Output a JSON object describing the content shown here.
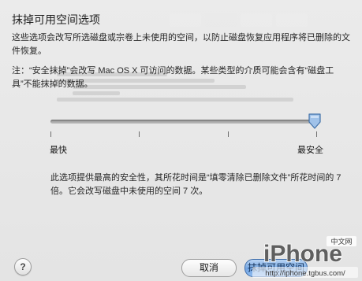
{
  "sheet": {
    "title": "抹掉可用空间选项",
    "description": "这些选项会改写所选磁盘或宗卷上未使用的空间，以防止磁盘恢复应用程序将已删除的文件恢复。",
    "note": "注：“安全抹掉”会改写 Mac OS X 可访问的数据。某些类型的介质可能会含有“磁盘工具”不能抹掉的数据。"
  },
  "slider": {
    "min_label": "最快",
    "max_label": "最安全",
    "tick_count": 4,
    "value_fraction": 1.0
  },
  "explanation": "此选项提供最高的安全性，其所花时间是“填零清除已删除文件”所花时间的 7 倍。它会改写磁盘中未使用的空间 7 次。",
  "buttons": {
    "help": "?",
    "cancel": "取消",
    "ok": "抹掉可用空间"
  },
  "watermark": {
    "brand": "iPhone",
    "badge": "中文网",
    "url": "http://iphone.tgbus.com/"
  },
  "colors": {
    "accent": "#6fa3e3",
    "thumb": "#9fc2ea"
  }
}
